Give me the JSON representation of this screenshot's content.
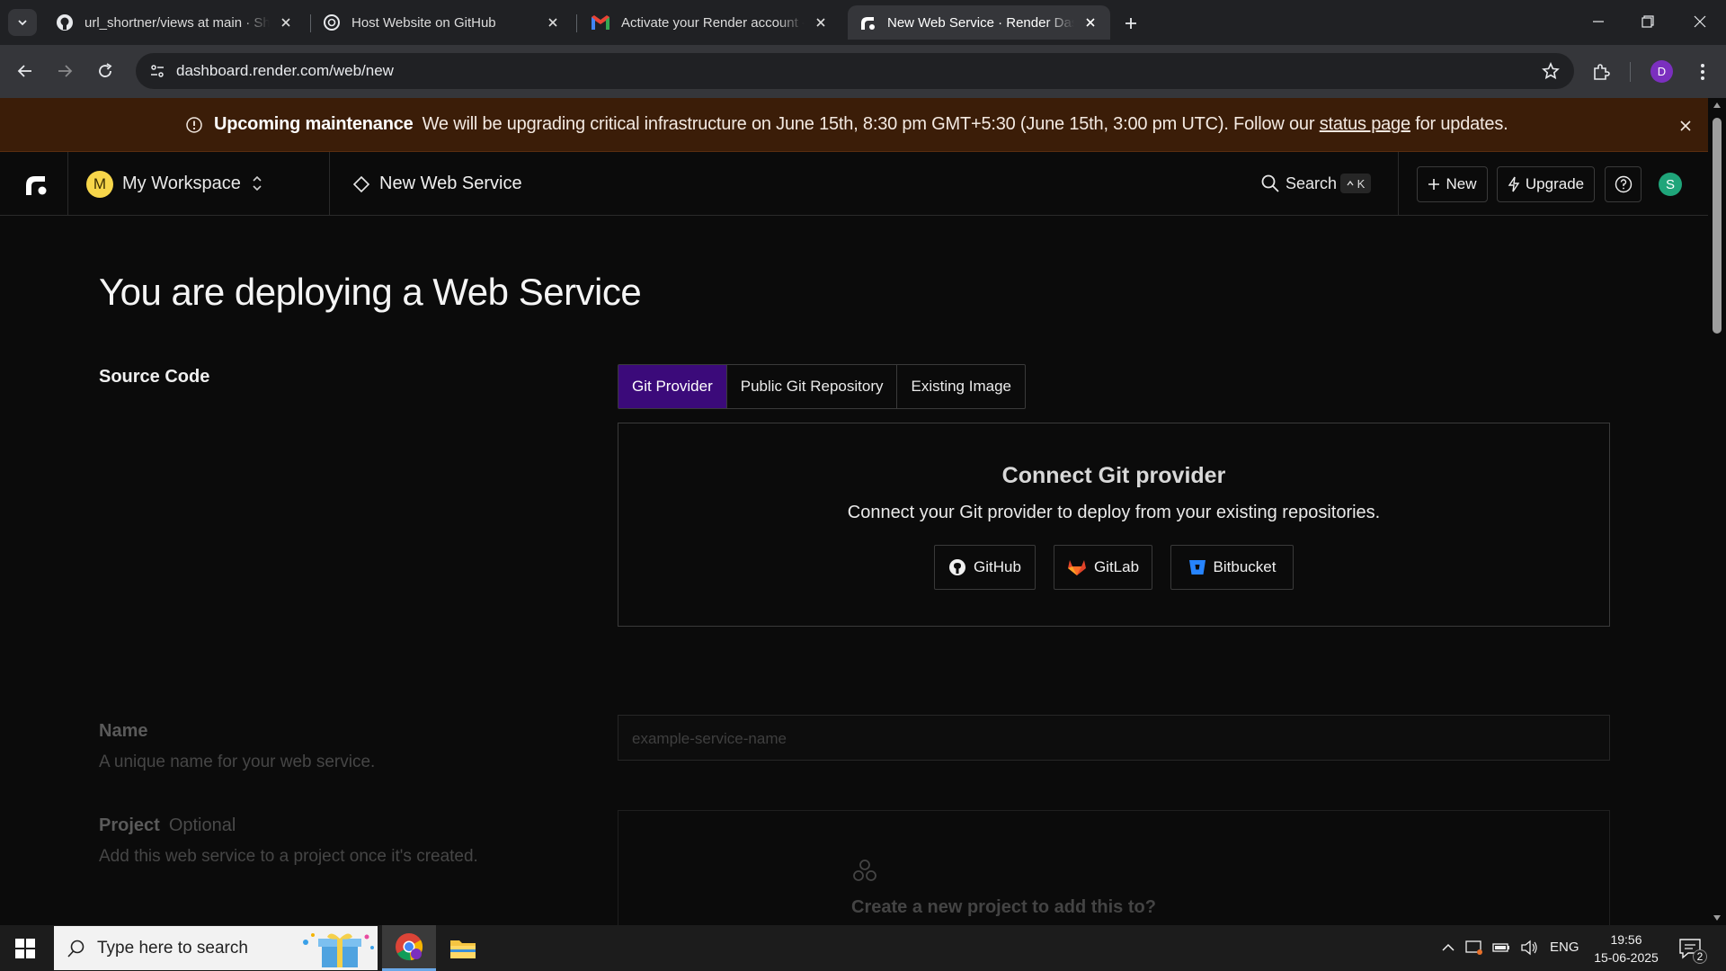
{
  "browser": {
    "tabs": [
      {
        "title": "url_shortner/views at main · Shr",
        "icon": "github-icon"
      },
      {
        "title": "Host Website on GitHub",
        "icon": "openai-icon"
      },
      {
        "title": "Activate your Render account -",
        "icon": "gmail-icon"
      },
      {
        "title": "New Web Service · Render Das",
        "icon": "render-icon",
        "active": true
      }
    ],
    "url": "dashboard.render.com/web/new",
    "profile_initial": "D"
  },
  "banner": {
    "title": "Upcoming maintenance",
    "message": "We will be upgrading critical infrastructure on June 15th, 8:30 pm GMT+5:30 (June 15th, 3:00 pm UTC). Follow our",
    "link_text": "status page",
    "suffix": "for updates.",
    "color": "#3b1d08"
  },
  "header": {
    "workspace_initial": "M",
    "workspace_name": "My Workspace",
    "breadcrumb": "New Web Service",
    "search_label": "Search",
    "search_shortcut": "K",
    "new_label": "New",
    "upgrade_label": "Upgrade",
    "user_initial": "S"
  },
  "main": {
    "title": "You are deploying a Web Service",
    "source_code_label": "Source Code",
    "source_tabs": [
      "Git Provider",
      "Public Git Repository",
      "Existing Image"
    ],
    "active_source_tab": "Git Provider",
    "connect": {
      "title": "Connect Git provider",
      "description": "Connect your Git provider to deploy from your existing repositories.",
      "providers": [
        "GitHub",
        "GitLab",
        "Bitbucket"
      ]
    },
    "name_field": {
      "label": "Name",
      "description": "A unique name for your web service.",
      "placeholder": "example-service-name"
    },
    "project_field": {
      "label": "Project",
      "optional_tag": "Optional",
      "description": "Add this web service to a project once it's created.",
      "empty_text": "Create a new project to add this to?"
    },
    "accent_color": "#3b0a7a"
  },
  "taskbar": {
    "search_placeholder": "Type here to search",
    "language": "ENG",
    "time": "19:56",
    "date": "15-06-2025",
    "notification_count": "2"
  }
}
